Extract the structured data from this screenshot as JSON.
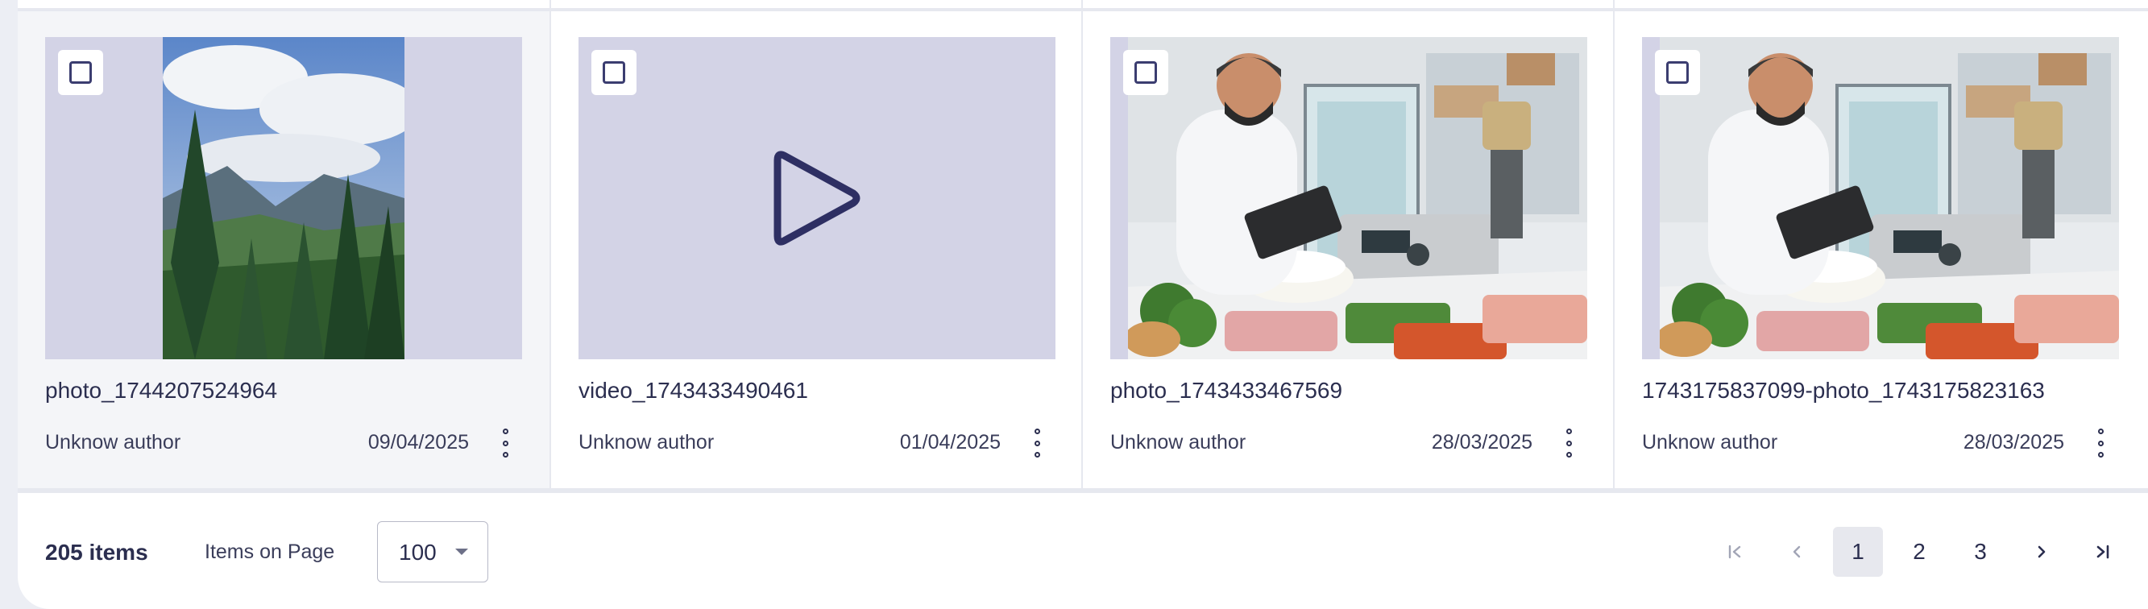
{
  "cards": [
    {
      "name": "photo_1744207524964",
      "author": "Unknow author",
      "date": "09/04/2025",
      "type": "photo-landscape",
      "icon": "checkbox-icon"
    },
    {
      "name": "video_1743433490461",
      "author": "Unknow author",
      "date": "01/04/2025",
      "type": "video",
      "icon": "play-icon"
    },
    {
      "name": "photo_1743433467569",
      "author": "Unknow author",
      "date": "28/03/2025",
      "type": "photo-lab"
    },
    {
      "name": "1743175837099-photo_1743175823163",
      "author": "Unknow author",
      "date": "28/03/2025",
      "type": "photo-lab"
    }
  ],
  "footer": {
    "count": "205 items",
    "items_on_page_label": "Items on Page",
    "items_on_page_value": "100",
    "pages": [
      "1",
      "2",
      "3"
    ],
    "current_page": "1"
  },
  "colors": {
    "accent": "#3b3d70",
    "thumb_bg": "#d3d3e6",
    "page_bg": "#e6e8ef"
  }
}
